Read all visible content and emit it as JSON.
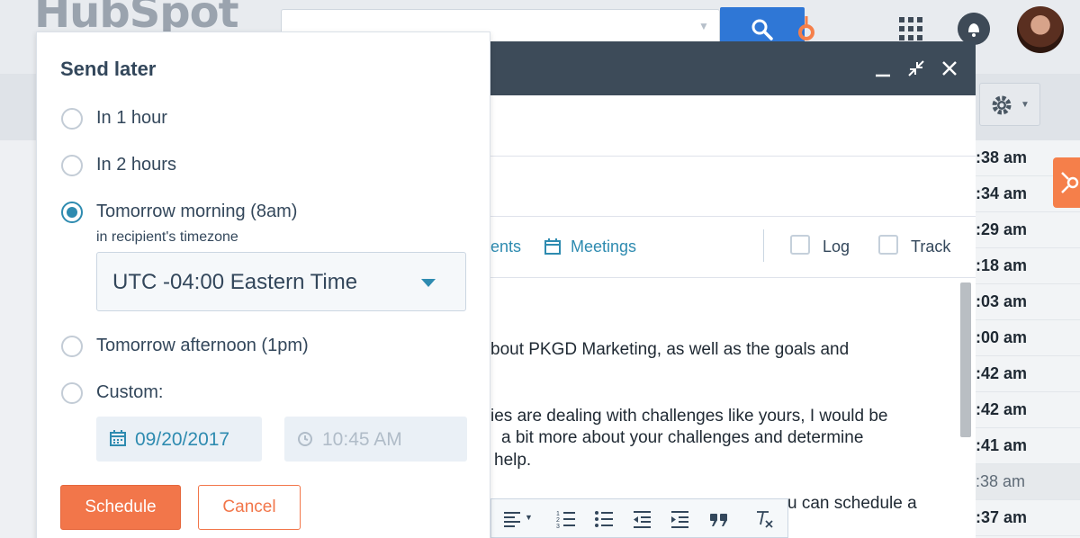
{
  "app": {
    "logo_text": "HubSpot"
  },
  "compose": {
    "toolbar": {
      "documents_label": "ents",
      "meetings_label": "Meetings",
      "log_label": "Log",
      "track_label": "Track"
    },
    "body_lines": [
      "bout PKGD Marketing, as well as the goals and",
      "ies are dealing with challenges like yours, I would be",
      "a bit more about your challenges and determine",
      "help.",
      "u can schedule a"
    ]
  },
  "activity_times": [
    ":38 am",
    ":34 am",
    ":29 am",
    ":18 am",
    ":03 am",
    ":00 am",
    ":42 am",
    ":42 am",
    ":41 am",
    ":38 am",
    ":37 am"
  ],
  "send_later": {
    "title": "Send later",
    "options": [
      {
        "label": "In 1 hour",
        "selected": false
      },
      {
        "label": "In 2 hours",
        "selected": false
      },
      {
        "label": "Tomorrow morning (8am)",
        "selected": true
      },
      {
        "label": "Tomorrow afternoon (1pm)",
        "selected": false
      },
      {
        "label": "Custom:",
        "selected": false
      }
    ],
    "timezone_note": "in recipient's timezone",
    "timezone_value": "UTC -04:00 Eastern Time",
    "custom_date": "09/20/2017",
    "custom_time_placeholder": "10:45 AM",
    "schedule_label": "Schedule",
    "cancel_label": "Cancel"
  },
  "colors": {
    "accent": "#2e8bb0",
    "primary_button": "#f2764a",
    "header_dark": "#3d4b59",
    "text": "#33475b"
  }
}
